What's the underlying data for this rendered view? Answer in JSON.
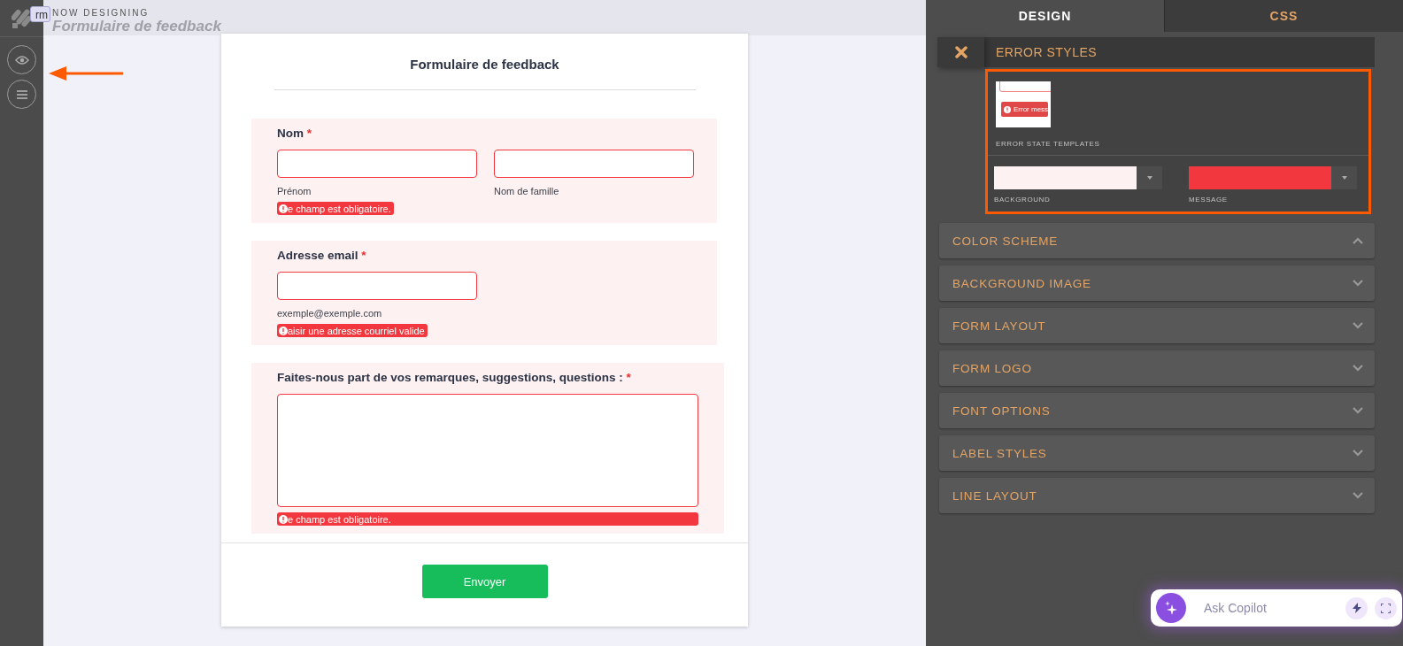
{
  "top_bar": {
    "form_switcher": "rm",
    "caption": "NOW DESIGNING",
    "form_title": "Formulaire de feedback"
  },
  "form": {
    "title": "Formulaire de feedback",
    "submit": "Envoyer",
    "sections": [
      {
        "kind": "name",
        "label": "Nom",
        "required_mark": "*",
        "fields": [
          {
            "kind": "text",
            "sublabel": "Prénom"
          },
          {
            "kind": "text",
            "sublabel": "Nom de famille"
          }
        ],
        "error": "e champ est obligatoire."
      },
      {
        "kind": "email",
        "label": "Adresse email",
        "required_mark": "*",
        "fields": [
          {
            "kind": "text",
            "sublabel": "exemple@exemple.com"
          }
        ],
        "error": "aisir une adresse courriel valide"
      },
      {
        "kind": "comments",
        "label": "Faites-nous part de vos remarques, suggestions, questions :",
        "required_mark": "*",
        "fields": [
          {
            "kind": "textarea"
          }
        ],
        "error": "e champ est obligatoire."
      }
    ]
  },
  "panel": {
    "tabs": [
      {
        "label": "DESIGN",
        "selected": true
      },
      {
        "label": "CSS",
        "selected": false
      }
    ],
    "error_styles": {
      "title": "ERROR STYLES",
      "preview_text": "Error mess",
      "templates_label": "ERROR STATE TEMPLATES",
      "colors": [
        {
          "label": "BACKGROUND",
          "color": "#fdf1f1"
        },
        {
          "label": "MESSAGE",
          "color": "#f2383e"
        }
      ]
    },
    "sections": [
      {
        "title": "COLOR SCHEME",
        "expanded": true
      },
      {
        "title": "BACKGROUND IMAGE",
        "expanded": false
      },
      {
        "title": "FORM LAYOUT",
        "expanded": false
      },
      {
        "title": "FORM LOGO",
        "expanded": false
      },
      {
        "title": "FONT OPTIONS",
        "expanded": false
      },
      {
        "title": "LABEL STYLES",
        "expanded": false
      },
      {
        "title": "LINE LAYOUT",
        "expanded": false
      }
    ]
  },
  "copilot": {
    "placeholder": "Ask Copilot"
  }
}
